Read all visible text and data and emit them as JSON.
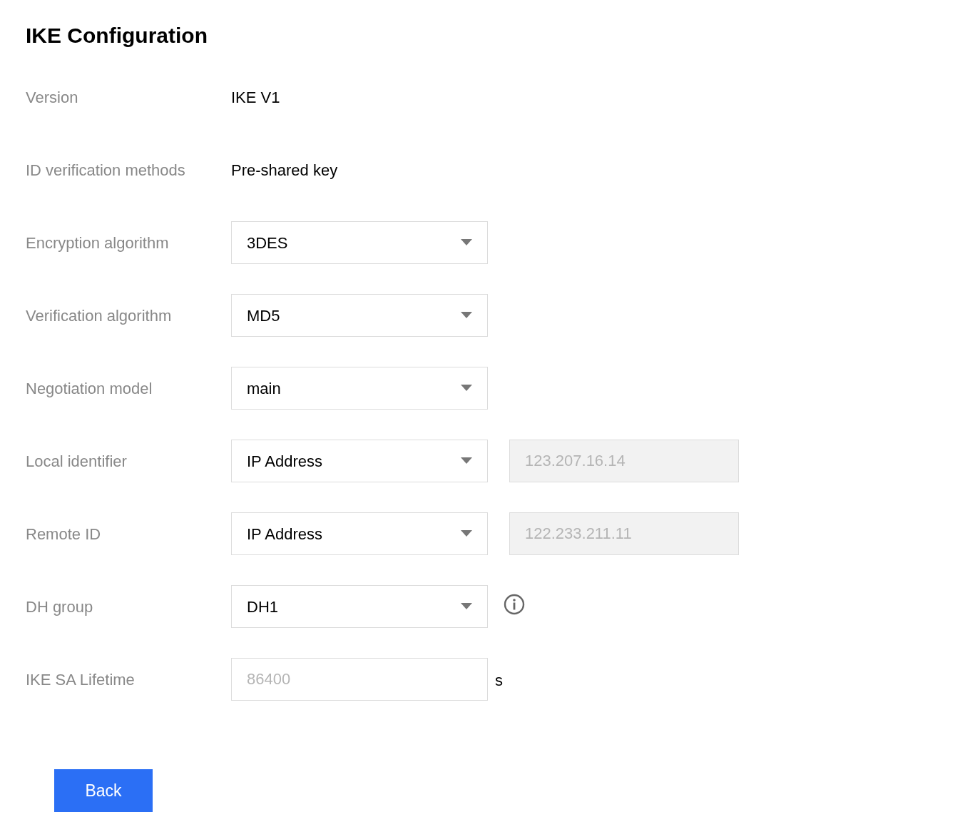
{
  "title": "IKE Configuration",
  "rows": [
    {
      "kind": "text",
      "label": "Version",
      "value": "IKE V1"
    },
    {
      "kind": "text",
      "label": "ID verification methods",
      "value": "Pre-shared key"
    },
    {
      "kind": "select",
      "label": "Encryption algorithm",
      "value": "3DES"
    },
    {
      "kind": "select",
      "label": "Verification algorithm",
      "value": "MD5"
    },
    {
      "kind": "select",
      "label": "Negotiation model",
      "value": "main"
    },
    {
      "kind": "select_with_input",
      "label": "Local identifier",
      "value": "IP Address",
      "input": {
        "value": "123.207.16.14",
        "disabled": true
      }
    },
    {
      "kind": "select_with_input",
      "label": "Remote ID",
      "value": "IP Address",
      "input": {
        "value": "122.233.211.11",
        "disabled": true
      }
    },
    {
      "kind": "select_with_info",
      "label": "DH group",
      "value": "DH1"
    },
    {
      "kind": "input_with_unit",
      "label": "IKE SA Lifetime",
      "placeholder": "86400",
      "unit": "s"
    }
  ],
  "back_button": "Back"
}
